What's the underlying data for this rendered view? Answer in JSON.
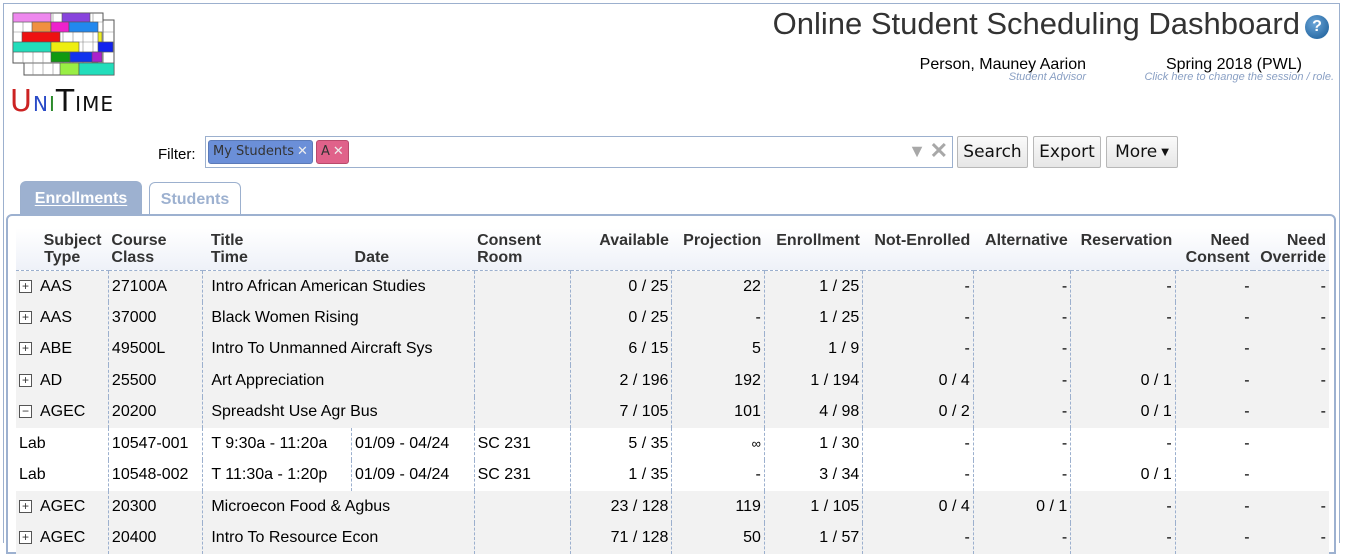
{
  "app": {
    "logo_text": "UniTime",
    "title": "Online Student Scheduling Dashboard",
    "help_icon": "question-circle-icon"
  },
  "user": {
    "name": "Person, Mauney Aarion",
    "role": "Student Advisor"
  },
  "session": {
    "name": "Spring 2018 (PWL)",
    "hint": "Click here to change the session / role."
  },
  "filter": {
    "label": "Filter:",
    "chips": [
      {
        "label": "My Students",
        "color": "#6b8fd8"
      },
      {
        "label": "A",
        "color": "#e0628a"
      }
    ],
    "value": ""
  },
  "buttons": {
    "search": "Search",
    "export": "Export",
    "more": "More"
  },
  "tabs": [
    {
      "label": "Enrollments",
      "active": true
    },
    {
      "label": "Students",
      "active": false
    }
  ],
  "table": {
    "headers": {
      "subject": "Subject",
      "type": "Type",
      "course": "Course",
      "class": "Class",
      "title": "Title",
      "time": "Time",
      "date": "Date",
      "consent": "Consent",
      "room": "Room",
      "available": "Available",
      "projection": "Projection",
      "enrollment": "Enrollment",
      "not_enrolled": "Not-Enrolled",
      "alternative": "Alternative",
      "reservation": "Reservation",
      "need_consent_1": "Need",
      "need_consent_2": "Consent",
      "need_override_1": "Need",
      "need_override_2": "Override"
    },
    "rows": [
      {
        "kind": "course",
        "expanded": false,
        "subject": "AAS",
        "course": "27100A",
        "title": "Intro African American Studies",
        "consent": "",
        "available": "0 / 25",
        "projection": "22",
        "enrollment": "1 / 25",
        "not_enrolled": "-",
        "alternative": "-",
        "reservation": "-",
        "need_consent": "-",
        "need_override": "-"
      },
      {
        "kind": "course",
        "expanded": false,
        "subject": "AAS",
        "course": "37000",
        "title": "Black Women Rising",
        "consent": "",
        "available": "0 / 25",
        "projection": "-",
        "enrollment": "1 / 25",
        "not_enrolled": "-",
        "alternative": "-",
        "reservation": "-",
        "need_consent": "-",
        "need_override": "-"
      },
      {
        "kind": "course",
        "expanded": false,
        "subject": "ABE",
        "course": "49500L",
        "title": "Intro To Unmanned Aircraft Sys",
        "consent": "",
        "available": "6 / 15",
        "projection": "5",
        "enrollment": "1 / 9",
        "not_enrolled": "-",
        "alternative": "-",
        "reservation": "-",
        "need_consent": "-",
        "need_override": "-"
      },
      {
        "kind": "course",
        "expanded": false,
        "subject": "AD",
        "course": "25500",
        "title": "Art Appreciation",
        "consent": "",
        "available": "2 / 196",
        "projection": "192",
        "enrollment": "1 / 194",
        "not_enrolled": "0 / 4",
        "alternative": "-",
        "reservation": "0 / 1",
        "need_consent": "-",
        "need_override": "-"
      },
      {
        "kind": "course",
        "expanded": true,
        "subject": "AGEC",
        "course": "20200",
        "title": "Spreadsht Use Agr Bus",
        "consent": "",
        "available": "7 / 105",
        "projection": "101",
        "enrollment": "4 / 98",
        "not_enrolled": "0 / 2",
        "alternative": "-",
        "reservation": "0 / 1",
        "need_consent": "-",
        "need_override": "-"
      },
      {
        "kind": "class",
        "type": "Lab",
        "class": "10547-001",
        "time": "T 9:30a - 11:20a",
        "date": "01/09 - 04/24",
        "room": "SC 231",
        "available": "5 / 35",
        "projection": "∞",
        "enrollment": "1 / 30",
        "not_enrolled": "-",
        "alternative": "-",
        "reservation": "-",
        "need_consent": "-",
        "need_override": ""
      },
      {
        "kind": "class",
        "type": "Lab",
        "class": "10548-002",
        "time": "T 11:30a - 1:20p",
        "date": "01/09 - 04/24",
        "room": "SC 231",
        "available": "1 / 35",
        "projection": "-",
        "enrollment": "3 / 34",
        "not_enrolled": "-",
        "alternative": "-",
        "reservation": "0 / 1",
        "need_consent": "-",
        "need_override": ""
      },
      {
        "kind": "course",
        "expanded": false,
        "subject": "AGEC",
        "course": "20300",
        "title": "Microecon Food & Agbus",
        "consent": "",
        "available": "23 / 128",
        "projection": "119",
        "enrollment": "1 / 105",
        "not_enrolled": "0 / 4",
        "alternative": "0 / 1",
        "reservation": "-",
        "need_consent": "-",
        "need_override": "-"
      },
      {
        "kind": "course",
        "expanded": false,
        "subject": "AGEC",
        "course": "20400",
        "title": "Intro To Resource Econ",
        "consent": "",
        "available": "71 / 128",
        "projection": "50",
        "enrollment": "1 / 57",
        "not_enrolled": "-",
        "alternative": "-",
        "reservation": "-",
        "need_consent": "-",
        "need_override": "-"
      }
    ]
  }
}
